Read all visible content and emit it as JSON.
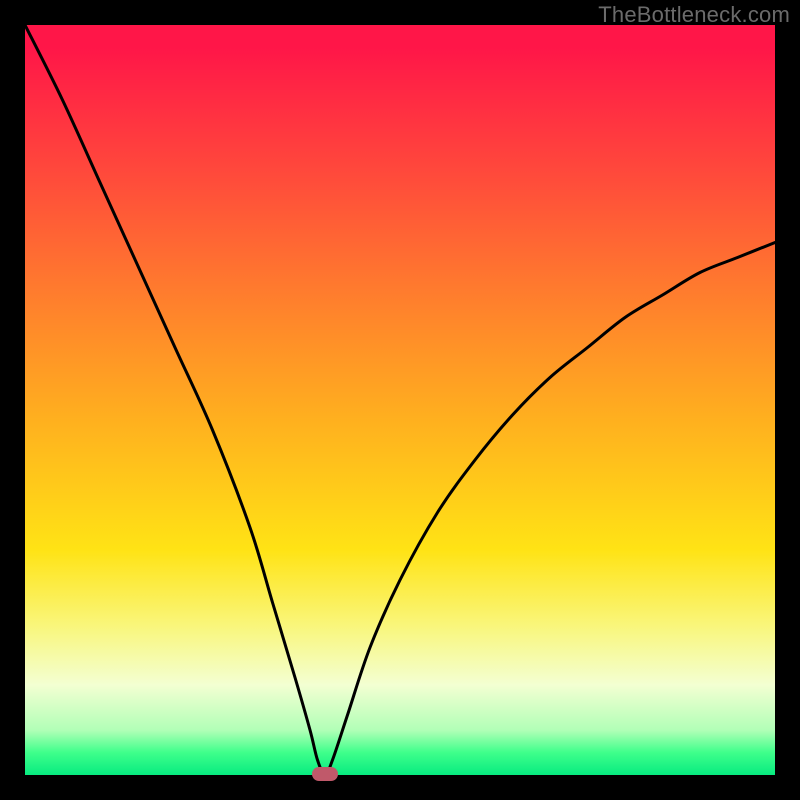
{
  "watermark": "TheBottleneck.com",
  "chart_data": {
    "type": "line",
    "title": "",
    "xlabel": "",
    "ylabel": "",
    "xlim": [
      0,
      100
    ],
    "ylim": [
      0,
      100
    ],
    "series": [
      {
        "name": "bottleneck-curve",
        "x": [
          0,
          5,
          10,
          15,
          20,
          25,
          30,
          33,
          36,
          38,
          39,
          40,
          41,
          43,
          46,
          50,
          55,
          60,
          65,
          70,
          75,
          80,
          85,
          90,
          95,
          100
        ],
        "values": [
          100,
          90,
          79,
          68,
          57,
          46,
          33,
          23,
          13,
          6,
          2,
          0,
          2,
          8,
          17,
          26,
          35,
          42,
          48,
          53,
          57,
          61,
          64,
          67,
          69,
          71
        ]
      }
    ],
    "marker": {
      "x": 40,
      "y": 0
    },
    "background_gradient": {
      "top": "#ff1648",
      "mid": "#ffe315",
      "bottom": "#07eb80"
    }
  }
}
